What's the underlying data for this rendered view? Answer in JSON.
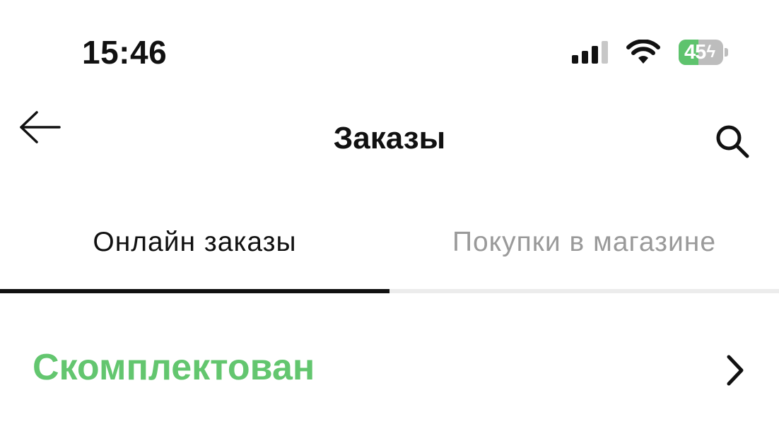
{
  "status_bar": {
    "time": "15:46",
    "battery_percent": "45",
    "battery_level": 0.45,
    "battery_charging": true,
    "icons": [
      "signal-icon",
      "wifi-icon",
      "battery-icon",
      "bolt-icon"
    ]
  },
  "header": {
    "title": "Заказы",
    "back_icon": "arrow-left-icon",
    "search_icon": "search-icon"
  },
  "tabs": [
    {
      "label": "Онлайн заказы",
      "active": true
    },
    {
      "label": "Покупки в магазине",
      "active": false
    }
  ],
  "order": {
    "status": "Скомплектован",
    "status_color": "#63c66f",
    "chevron_icon": "chevron-right-icon"
  },
  "colors": {
    "text": "#111111",
    "inactive_tab": "#9a9a9a",
    "battery_fill": "#5ec36d",
    "tab_track": "#ececec"
  }
}
